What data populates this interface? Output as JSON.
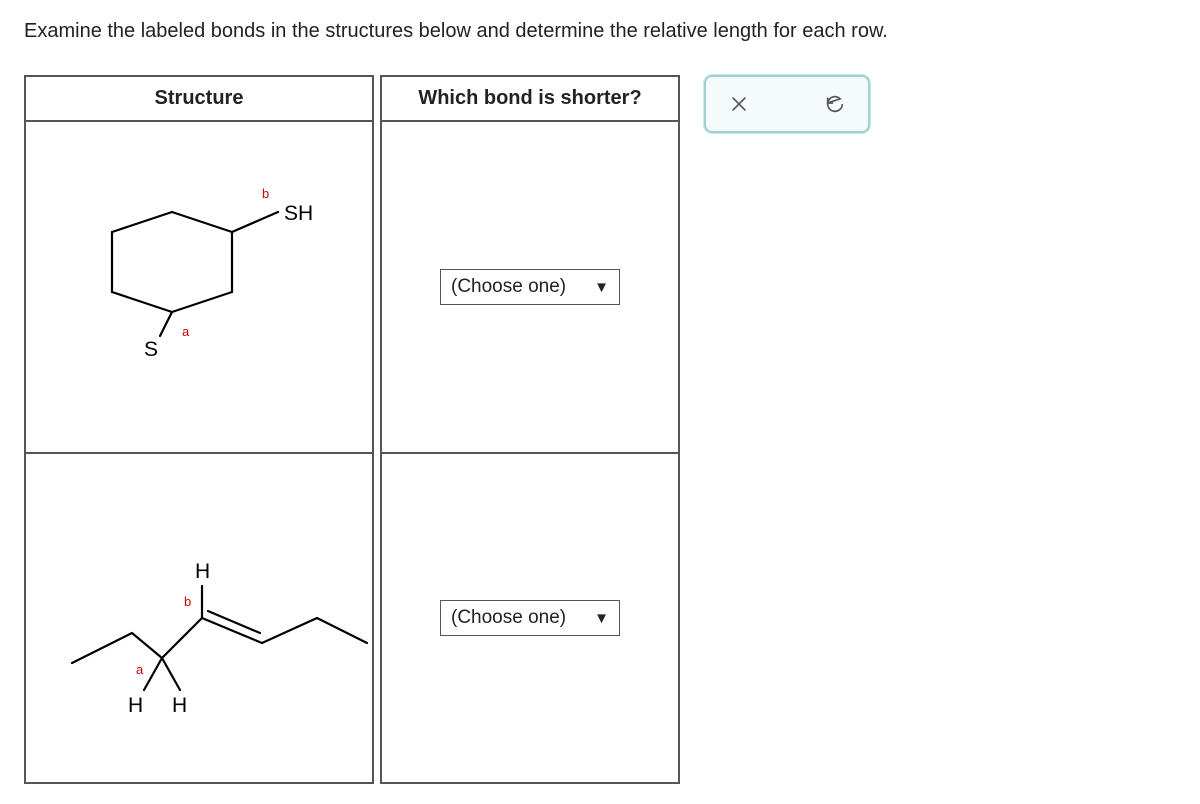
{
  "prompt": "Examine the labeled bonds in the structures below and determine the relative length for each row.",
  "headers": {
    "structure": "Structure",
    "answer": "Which bond is shorter?"
  },
  "rows": [
    {
      "select_placeholder": "(Choose one)",
      "labels": {
        "a": "a",
        "b": "b",
        "S": "S",
        "SH": "SH"
      }
    },
    {
      "select_placeholder": "(Choose one)",
      "labels": {
        "a": "a",
        "b": "b",
        "H1": "H",
        "H2": "H",
        "H3": "H"
      }
    }
  ],
  "toolbar": {
    "close": "close",
    "reset": "reset"
  }
}
